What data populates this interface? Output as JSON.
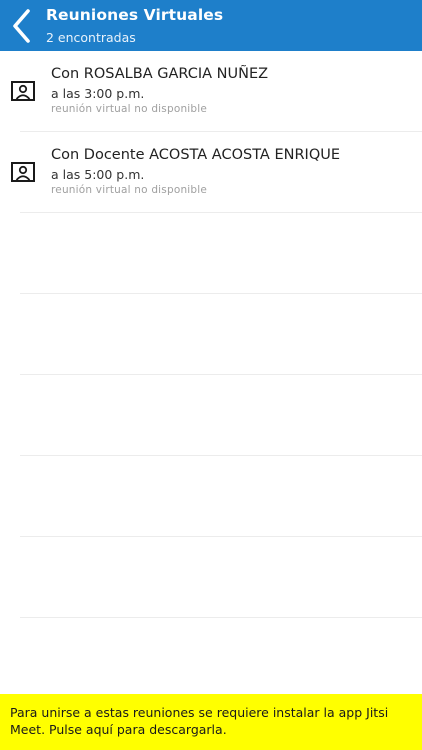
{
  "header": {
    "title": "Reuniones Virtuales",
    "subtitle": "2 encontradas",
    "back_icon": "chevron-left-icon",
    "background_color": "#1e7fca"
  },
  "meetings": [
    {
      "title": "Con ROSALBA GARCIA NUÑEZ",
      "time": "a las 3:00 p.m.",
      "status": "reunión virtual no disponible",
      "icon": "person-icon"
    },
    {
      "title": "Con Docente ACOSTA ACOSTA ENRIQUE",
      "time": "a las 5:00 p.m.",
      "status": "reunión virtual no disponible",
      "icon": "person-icon"
    }
  ],
  "banner": {
    "text": "Para unirse a estas reuniones se requiere instalar la app Jitsi Meet. Pulse aquí para descargarla.",
    "background_color": "#ffff00"
  }
}
